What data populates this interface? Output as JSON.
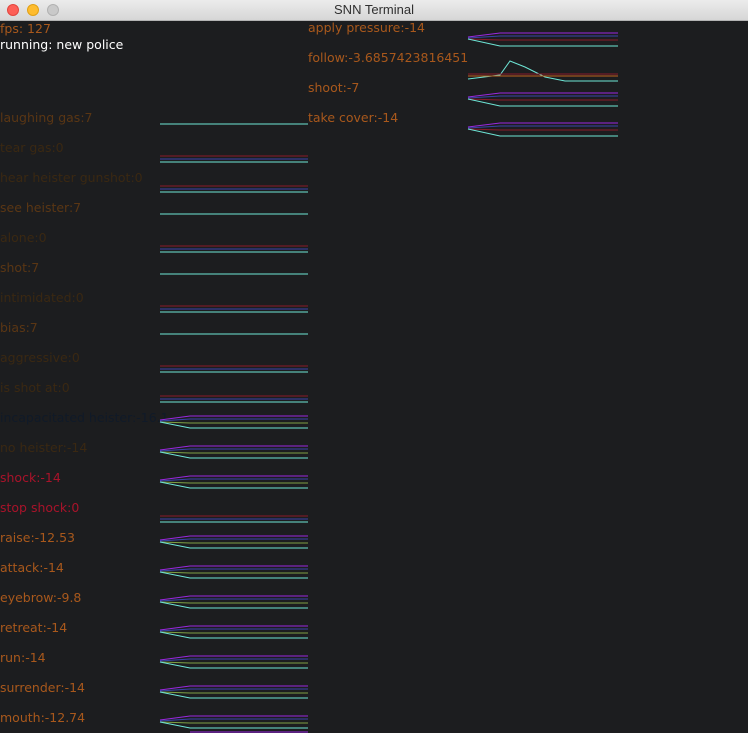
{
  "window": {
    "title": "SNN Terminal"
  },
  "status": {
    "fps": "fps: 127",
    "running": "running: new police"
  },
  "colors": {
    "background": "#1c1d1f",
    "white_text": "#ffffff",
    "inactive_text": "#3b2a10",
    "active_text": "#a8581c",
    "dark_text": "#0f1a27",
    "red_text": "#a8132a",
    "trace_cyan": "#6ee6d6",
    "trace_red": "#8a1a2a",
    "trace_purple": "#9a28e0",
    "trace_orange": "#c0621c",
    "trace_green": "#7ea044",
    "trace_blue": "#3a42a8"
  },
  "inputs": [
    {
      "label": "laughing gas:7",
      "color": "#5a3614",
      "traces": [
        "flat"
      ]
    },
    {
      "label": "tear gas:0",
      "color": "#3a2812",
      "traces": [
        "red"
      ]
    },
    {
      "label": "hear heister gunshot:0",
      "color": "#3a2812",
      "traces": [
        "red"
      ]
    },
    {
      "label": "see heister:7",
      "color": "#5a3614",
      "traces": [
        "flat"
      ]
    },
    {
      "label": "alone:0",
      "color": "#3a2812",
      "traces": [
        "red"
      ]
    },
    {
      "label": "shot:7",
      "color": "#5a3614",
      "traces": [
        "flat"
      ]
    },
    {
      "label": "intimidated:0",
      "color": "#3a2812",
      "traces": [
        "red"
      ]
    },
    {
      "label": "bias:7",
      "color": "#5a3614",
      "traces": [
        "flat"
      ]
    },
    {
      "label": "aggressive:0",
      "color": "#3a2812",
      "traces": [
        "red"
      ]
    },
    {
      "label": "is shot at:0",
      "color": "#3a2812",
      "traces": [
        "red"
      ]
    },
    {
      "label": "incapacitated heister:-16.1",
      "color": "#101a28",
      "traces": [
        "decay"
      ]
    },
    {
      "label": "no heister:-14",
      "color": "#3a2812",
      "traces": [
        "decay"
      ]
    },
    {
      "label": "shock:-14",
      "color": "#a8132a",
      "traces": [
        "decay"
      ]
    },
    {
      "label": "stop shock:0",
      "color": "#a8132a",
      "traces": [
        "red"
      ]
    },
    {
      "label": "raise:-12.53",
      "color": "#a8581c",
      "traces": [
        "decay"
      ]
    },
    {
      "label": "attack:-14",
      "color": "#a8581c",
      "traces": [
        "decay"
      ]
    },
    {
      "label": "eyebrow:-9.8",
      "color": "#a8581c",
      "traces": [
        "decay"
      ]
    },
    {
      "label": "retreat:-14",
      "color": "#a8581c",
      "traces": [
        "decay"
      ]
    },
    {
      "label": "run:-14",
      "color": "#a8581c",
      "traces": [
        "decay"
      ]
    },
    {
      "label": "surrender:-14",
      "color": "#a8581c",
      "traces": [
        "decay"
      ]
    },
    {
      "label": "mouth:-12.74",
      "color": "#a8581c",
      "traces": [
        "decay"
      ]
    }
  ],
  "outputs": [
    {
      "label": "apply pressure:-14",
      "color": "#a8581c"
    },
    {
      "label": "follow:-3.6857423816451",
      "color": "#a8581c"
    },
    {
      "label": "shoot:-7",
      "color": "#a8581c"
    },
    {
      "label": "take cover:-14",
      "color": "#a8581c"
    }
  ]
}
